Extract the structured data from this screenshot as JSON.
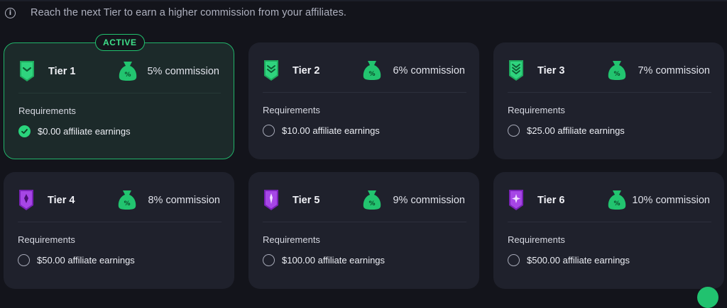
{
  "info": {
    "text": "Reach the next Tier to earn a higher commission from your affiliates.",
    "icon": "info-icon"
  },
  "colors": {
    "background": "#13141b",
    "card": "#1f212c",
    "accent_green": "#21c26f",
    "badge_green": "#22c46f",
    "badge_purple": "#8b2fd0"
  },
  "active_badge": "ACTIVE",
  "requirements_label": "Requirements",
  "tiers": [
    {
      "name": "Tier 1",
      "commission": "5% commission",
      "requirement": "$0.00 affiliate earnings",
      "completed": true,
      "active": true
    },
    {
      "name": "Tier 2",
      "commission": "6% commission",
      "requirement": "$10.00 affiliate earnings",
      "completed": false,
      "active": false
    },
    {
      "name": "Tier 3",
      "commission": "7% commission",
      "requirement": "$25.00 affiliate earnings",
      "completed": false,
      "active": false
    },
    {
      "name": "Tier 4",
      "commission": "8% commission",
      "requirement": "$50.00 affiliate earnings",
      "completed": false,
      "active": false
    },
    {
      "name": "Tier 5",
      "commission": "9% commission",
      "requirement": "$100.00 affiliate earnings",
      "completed": false,
      "active": false
    },
    {
      "name": "Tier 6",
      "commission": "10% commission",
      "requirement": "$500.00 affiliate earnings",
      "completed": false,
      "active": false
    }
  ]
}
